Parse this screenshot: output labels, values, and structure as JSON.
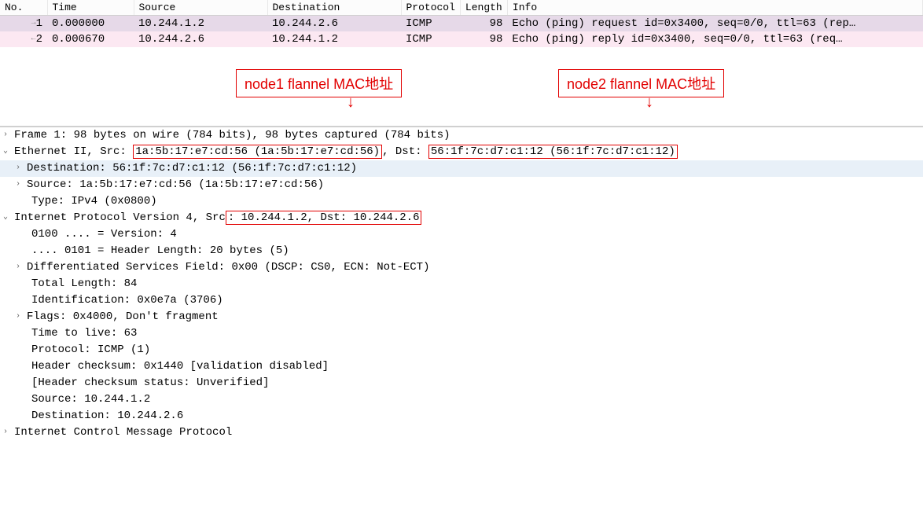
{
  "table": {
    "headers": {
      "no": "No.",
      "time": "Time",
      "source": "Source",
      "destination": "Destination",
      "protocol": "Protocol",
      "length": "Length",
      "info": "Info"
    },
    "rows": [
      {
        "no": "1",
        "time": "0.000000",
        "source": "10.244.1.2",
        "destination": "10.244.2.6",
        "protocol": "ICMP",
        "length": "98",
        "info": "Echo (ping) request  id=0x3400, seq=0/0, ttl=63 (rep…"
      },
      {
        "no": "2",
        "time": "0.000670",
        "source": "10.244.2.6",
        "destination": "10.244.1.2",
        "protocol": "ICMP",
        "length": "98",
        "info": "Echo (ping) reply    id=0x3400, seq=0/0, ttl=63 (req…"
      }
    ]
  },
  "annotations": {
    "node1": "node1 flannel MAC地址",
    "node2": "node2 flannel MAC地址"
  },
  "details": {
    "frame": "Frame 1: 98 bytes on wire (784 bits), 98 bytes captured (784 bits)",
    "eth_prefix": "Ethernet II, Src: ",
    "eth_src_box": "1a:5b:17:e7:cd:56 (1a:5b:17:e7:cd:56)",
    "eth_mid": ", Dst: ",
    "eth_dst_box": "56:1f:7c:d7:c1:12 (56:1f:7c:d7:c1:12)",
    "eth_dest": "Destination: 56:1f:7c:d7:c1:12 (56:1f:7c:d7:c1:12)",
    "eth_source": "Source: 1a:5b:17:e7:cd:56 (1a:5b:17:e7:cd:56)",
    "eth_type": "Type: IPv4 (0x0800)",
    "ip_prefix": "Internet Protocol Version 4, Src",
    "ip_box": ": 10.244.1.2, Dst: 10.244.2.6",
    "ip_version": "0100 .... = Version: 4",
    "ip_hlen": ".... 0101 = Header Length: 20 bytes (5)",
    "ip_dsf": "Differentiated Services Field: 0x00 (DSCP: CS0, ECN: Not-ECT)",
    "ip_total": "Total Length: 84",
    "ip_id": "Identification: 0x0e7a (3706)",
    "ip_flags": "Flags: 0x4000, Don't fragment",
    "ip_ttl": "Time to live: 63",
    "ip_proto": "Protocol: ICMP (1)",
    "ip_chksum": "Header checksum: 0x1440 [validation disabled]",
    "ip_chksum_status": "[Header checksum status: Unverified]",
    "ip_src": "Source: 10.244.1.2",
    "ip_dst": "Destination: 10.244.2.6",
    "icmp": "Internet Control Message Protocol"
  }
}
